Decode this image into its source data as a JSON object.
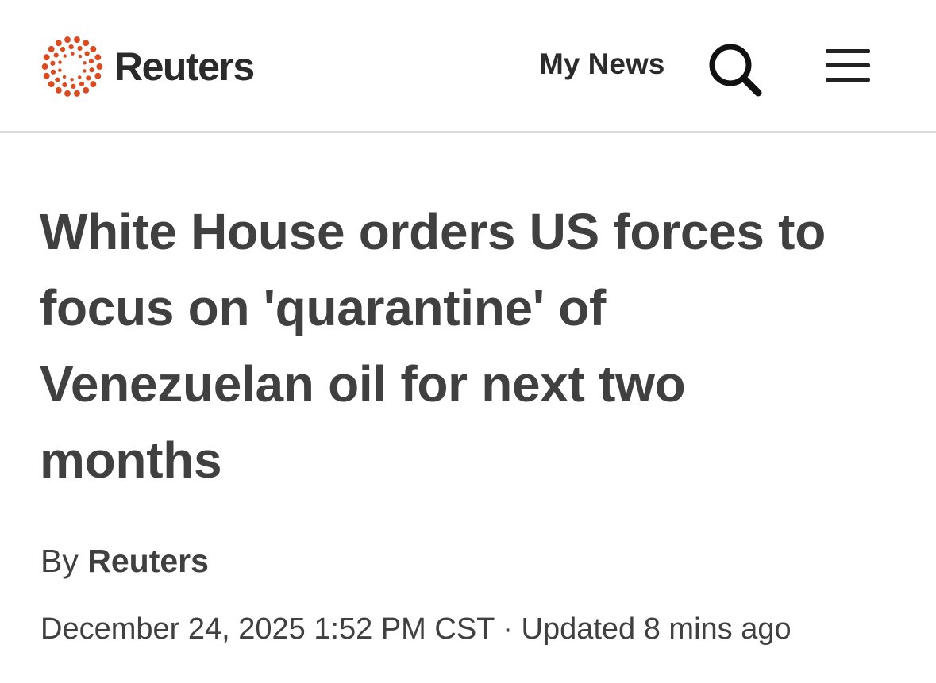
{
  "header": {
    "logo_text": "Reuters",
    "my_news_label": "My News",
    "search_icon": "search-icon",
    "menu_icon": "hamburger-menu-icon",
    "brand_color": "#dc4b20"
  },
  "article": {
    "headline": "White House orders US forces to focus on 'quarantine' of Venezuelan oil for next two months",
    "byline_prefix": "By",
    "byline_author": "Reuters",
    "date": "December 24, 2025 1:52 PM CST",
    "separator": "·",
    "updated": "Updated 8 mins ago"
  }
}
